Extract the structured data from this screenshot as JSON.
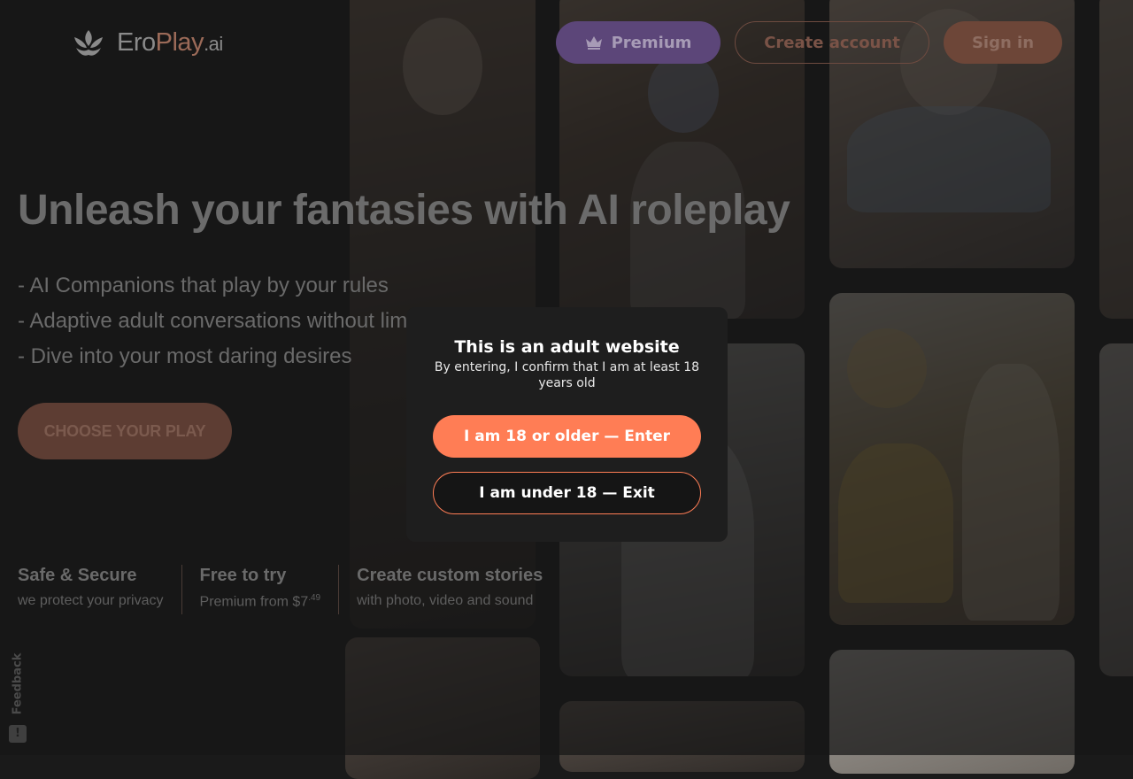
{
  "brand": {
    "name_part1": "Ero",
    "name_part2": "Play",
    "name_part3": ".ai",
    "logo_icon": "leaf-mask-icon"
  },
  "header": {
    "premium_label": "Premium",
    "premium_icon": "crown-icon",
    "create_account_label": "Create account",
    "sign_in_label": "Sign in"
  },
  "hero": {
    "title": "Unleash your fantasies with AI roleplay",
    "features": [
      "- AI Companions that play by your rules",
      "- Adaptive adult conversations without limits",
      "- Dive into your most daring desires"
    ],
    "cta_label": "CHOOSE YOUR PLAY"
  },
  "stats": [
    {
      "title": "Safe & Secure",
      "subtitle": "we protect your privacy"
    },
    {
      "title": "Free to try",
      "subtitle": "Premium from $7",
      "subtitle_sup": ".49"
    },
    {
      "title": "Create custom stories",
      "subtitle": "with photo, video and sound"
    }
  ],
  "feedback": {
    "label": "Feedback",
    "icon": "exclamation-icon"
  },
  "age_gate": {
    "title": "This is an adult website",
    "subtitle": "By entering, I confirm that I am at least 18 years old",
    "enter_label": "I am 18 or older — Enter",
    "exit_label": "I am under 18 — Exit"
  },
  "colors": {
    "accent": "#ff7d55",
    "premium": "#8a61c8",
    "modal_bg": "#1e1e1e"
  }
}
